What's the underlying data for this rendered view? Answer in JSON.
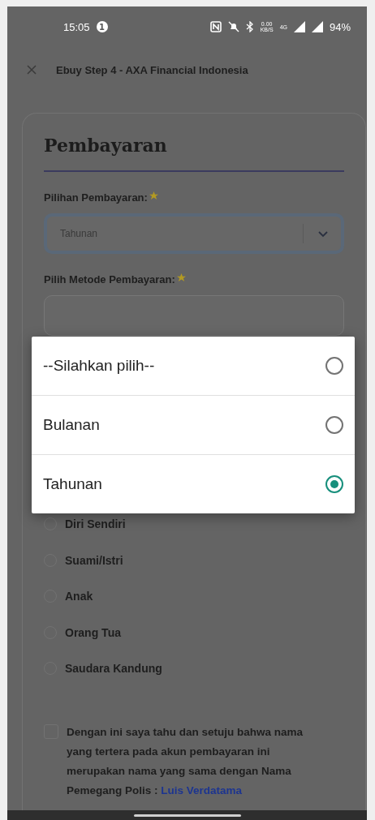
{
  "status_bar": {
    "time": "15:05",
    "notification_count": "1",
    "speed": "0.00",
    "speed_unit": "KB/S",
    "network": "4G",
    "battery": "94%"
  },
  "header": {
    "title": "Ebuy Step 4 - AXA Financial Indonesia"
  },
  "form": {
    "heading": "Pembayaran",
    "fields": [
      {
        "label": "Pilihan Pembayaran:",
        "required": true,
        "value": "Tahunan",
        "focused": true
      },
      {
        "label": "Pilih Metode Pembayaran:",
        "required": true,
        "focused": false
      }
    ],
    "relations": [
      {
        "label": "Diri Sendiri",
        "selected": false
      },
      {
        "label": "Suami/Istri",
        "selected": false
      },
      {
        "label": "Anak",
        "selected": false
      },
      {
        "label": "Orang Tua",
        "selected": false
      },
      {
        "label": "Saudara Kandung",
        "selected": false
      }
    ],
    "agreement": {
      "text": "Dengan ini saya tahu dan setuju bahwa nama yang tertera pada akun pembayaran ini merupakan nama yang sama dengan Nama Pemegang Polis : ",
      "link": "Luis Verdatama",
      "checked": false
    }
  },
  "dialog": {
    "options": [
      {
        "label": "--Silahkan pilih--",
        "selected": false
      },
      {
        "label": "Bulanan",
        "selected": false
      },
      {
        "label": "Tahunan",
        "selected": true
      }
    ]
  }
}
